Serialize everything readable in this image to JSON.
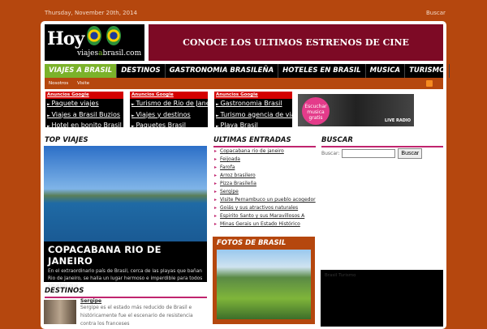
{
  "topbar": {
    "date": "Thursday, November 20th, 2014",
    "search_link": "Buscar"
  },
  "logo": {
    "big": "Hoy",
    "domain_a": "viajes",
    "domain_b": "a",
    "domain_c": "brasil.com"
  },
  "banner": "CONOCE LOS ULTIMOS ESTRENOS DE CINE",
  "nav": [
    "VIAJES A BRASIL",
    "DESTINOS",
    "GASTRONOMIA BRASILEÑA",
    "HOTELES EN BRASIL",
    "MUSICA",
    "TURISMO"
  ],
  "subnav": [
    "Nosotros",
    "Visite"
  ],
  "ads": [
    {
      "header": "Anuncios Google",
      "links": [
        "Paquete viajes",
        "Viajes a Brasil Buzios",
        "Hotel en bonito Brasil"
      ]
    },
    {
      "header": "Anuncios Google",
      "links": [
        "Turismo de Rio de Janeiro",
        "Viajes y destinos",
        "Paquetes Brasil"
      ]
    },
    {
      "header": "Anuncios Google",
      "links": [
        "Gastronomia Brasil",
        "Turismo agencia de viajes",
        "Playa Brasil"
      ]
    }
  ],
  "radio": {
    "text": "Escuchar musica gratis",
    "badge": "LIVE RADIO"
  },
  "top_viajes": {
    "heading": "TOP VIAJES",
    "title": "COPACABANA RIO DE JANEIRO",
    "excerpt": "En el extraordinario país de Brasil, cerca de las playas que bañan Rio de Janeiro, se halla un lugar hermoso e imperdible para todos aquellos que ..."
  },
  "destinos": {
    "heading": "DESTINOS",
    "item_title": "Sergipe",
    "item_text": "Sergipe es el estado más reducido de Brasil e históricamente fue el escenario de resistencia contra los franceses"
  },
  "ultimas": {
    "heading": "ULTIMAS ENTRADAS",
    "items": [
      "Copacabana rio de janeiro",
      "Feijoada",
      "Farofa",
      "Arroz brasilero",
      "Pizza Brasileña",
      "Sergipe",
      "Visite Pernambuco un pueblo acogedor",
      "Goiás y sus atractivos naturales",
      "Espirito Santo y sus Maravillosos A",
      "Minas Gerais un Estado Histórico"
    ]
  },
  "fotos": {
    "heading": "FOTOS DE BRASIL"
  },
  "buscar": {
    "heading": "BUSCAR",
    "label": "Buscar:",
    "value": "",
    "button": "Buscar"
  },
  "widget": {
    "title": "Brasil Turismo"
  }
}
